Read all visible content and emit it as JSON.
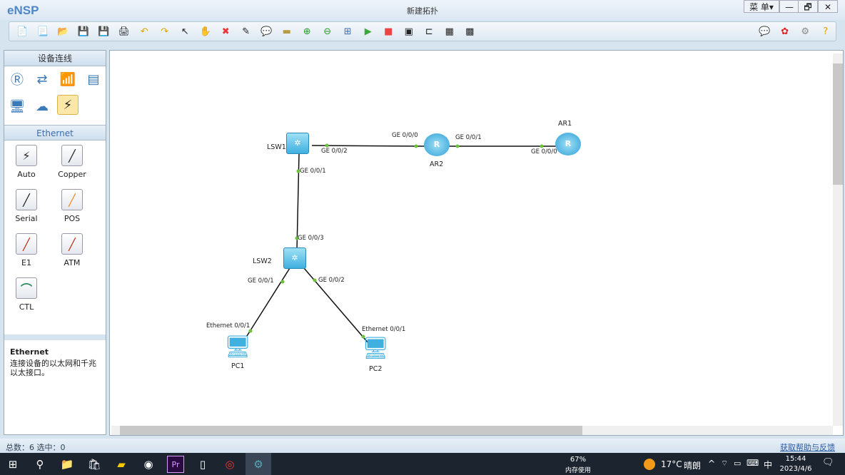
{
  "window": {
    "app": "eNSP",
    "title": "新建拓扑",
    "menu": "菜 单▾",
    "minimize": "—",
    "restore": "🗗",
    "close": "✕"
  },
  "toolbar": [
    "new-topology",
    "new-example",
    "open",
    "save",
    "save-as",
    "print",
    "undo",
    "redo",
    "select",
    "pan",
    "delete",
    "delete-link",
    "text",
    "palette",
    "zoom-in",
    "zoom-out",
    "fit",
    "start",
    "stop",
    "capture",
    "topology",
    "grid",
    "console"
  ],
  "toolbar_right": [
    "feedback",
    "huawei",
    "settings",
    "help"
  ],
  "panel": {
    "devices_title": "设备连线",
    "devices": [
      "router",
      "switch",
      "wireless",
      "firewall",
      "pc",
      "cloud",
      "connection"
    ],
    "cables_title": "Ethernet",
    "cables": [
      {
        "label": "Auto",
        "color": "#222"
      },
      {
        "label": "Copper",
        "color": "#111"
      },
      {
        "label": "Serial",
        "color": "#111"
      },
      {
        "label": "POS",
        "color": "#f08a2a"
      },
      {
        "label": "E1",
        "color": "#c0321a"
      },
      {
        "label": "ATM",
        "color": "#c0321a"
      },
      {
        "label": "CTL",
        "color": "#2a8a5a"
      }
    ],
    "desc_title": "Ethernet",
    "desc_text": "连接设备的以太网和千兆以太接口。"
  },
  "topology": {
    "nodes": [
      {
        "name": "LSW1",
        "type": "switch"
      },
      {
        "name": "AR2",
        "type": "router"
      },
      {
        "name": "AR1",
        "type": "router"
      },
      {
        "name": "LSW2",
        "type": "switch"
      },
      {
        "name": "PC1",
        "type": "pc"
      },
      {
        "name": "PC2",
        "type": "pc"
      }
    ],
    "links": [
      {
        "a": "LSW1",
        "a_port": "GE 0/0/2",
        "b": "AR2",
        "b_port": "GE 0/0/0"
      },
      {
        "a": "AR2",
        "a_port": "GE 0/0/1",
        "b": "AR1",
        "b_port": "GE 0/0/0"
      },
      {
        "a": "LSW1",
        "a_port": "GE 0/0/1",
        "b": "LSW2",
        "b_port": "GE 0/0/3"
      },
      {
        "a": "LSW2",
        "a_port": "GE 0/0/1",
        "b": "PC1",
        "b_port": "Ethernet 0/0/1"
      },
      {
        "a": "LSW2",
        "a_port": "GE 0/0/2",
        "b": "PC2",
        "b_port": "Ethernet 0/0/1"
      }
    ]
  },
  "status": {
    "left": "总数：6  选中：0",
    "help": "获取帮助与反馈"
  },
  "taskbar": {
    "memory_pct": "67%",
    "memory_label": "内存使用",
    "temp": "17°C",
    "weather": "晴朗",
    "ime": "中",
    "time": "15:44",
    "date": "2023/4/6"
  }
}
